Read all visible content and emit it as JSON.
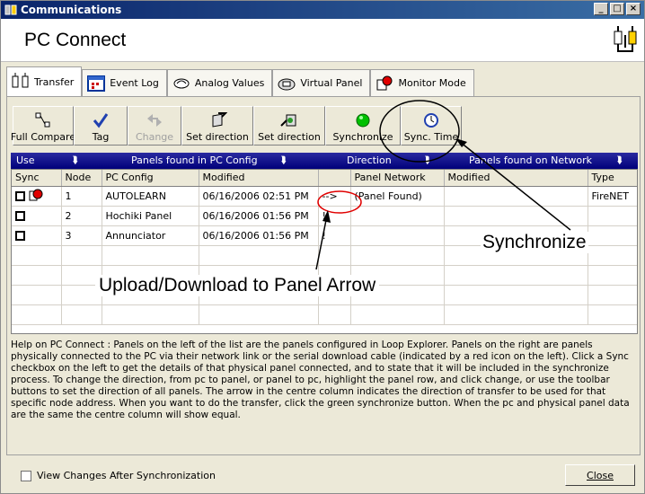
{
  "window": {
    "title": "Communications",
    "min_glyph": "_",
    "max_glyph": "□",
    "close_glyph": "×"
  },
  "header": {
    "title": "PC Connect"
  },
  "tabs": [
    {
      "label": "Transfer",
      "icon": "transfer-icon"
    },
    {
      "label": "Event Log",
      "icon": "event-log-icon"
    },
    {
      "label": "Analog Values",
      "icon": "analog-icon"
    },
    {
      "label": "Virtual Panel",
      "icon": "virtual-panel-icon"
    },
    {
      "label": "Monitor Mode",
      "icon": "monitor-icon"
    }
  ],
  "toolbar": {
    "full_compare": "Full Compare",
    "tag": "Tag",
    "change": "Change",
    "set_direction_1": "Set direction",
    "set_direction_2": "Set direction",
    "synchronize": "Synchronize",
    "sync_time": "Sync. Time"
  },
  "bluebar": {
    "use": "Use",
    "pc_config": "Panels found in PC Config",
    "direction": "Direction",
    "network": "Panels found on Network"
  },
  "columns": {
    "sync": "Sync",
    "node": "Node",
    "pc_config": "PC Config",
    "modified": "Modified",
    "direction": "",
    "panel_network": "Panel Network",
    "modified2": "Modified",
    "type": "Type"
  },
  "rows": [
    {
      "node": "1",
      "pc_config": "AUTOLEARN",
      "modified": "06/16/2006 02:51 PM",
      "direction": "-->",
      "panel_network": "(Panel Found)",
      "modified2": "",
      "type": "FireNET"
    },
    {
      "node": "2",
      "pc_config": "Hochiki Panel",
      "modified": "06/16/2006 01:56 PM",
      "direction": "!",
      "panel_network": "",
      "modified2": "",
      "type": ""
    },
    {
      "node": "3",
      "pc_config": "Annunciator",
      "modified": "06/16/2006 01:56 PM",
      "direction": "!",
      "panel_network": "",
      "modified2": "",
      "type": ""
    }
  ],
  "help_text": "Help on PC Connect : Panels on the left of the list are the panels configured in Loop Explorer. Panels on the right are panels physically connected to the PC via their network link or the serial download cable (indicated by a red icon on the left). Click a Sync checkbox on the left to get the details of that physical panel connected, and to state that it will be included in the synchronize process. To change the direction, from pc to panel, or panel to pc, highlight the panel row, and click change, or use the toolbar buttons to set the direction of all panels. The arrow in the centre column indicates the direction of transfer to be used for that specific node address. When you want to do the transfer, click the green synchronize button. When the pc and physical panel data are the same the centre column will show equal.",
  "bottom": {
    "view_changes": "View Changes After Synchronization",
    "close": "Close"
  },
  "annotations": {
    "synchronize": "Synchronize",
    "upload_download": "Upload/Download to Panel Arrow"
  },
  "colors": {
    "title_bar": "#0a246a",
    "blue_header": "#00007a",
    "annotation_red": "#e00000",
    "sync_green": "#00c000"
  }
}
